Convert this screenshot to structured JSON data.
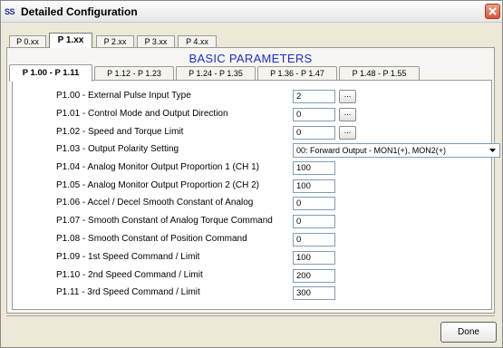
{
  "window": {
    "app_icon_text": "SS",
    "title": "Detailed Configuration"
  },
  "top_tabs": [
    {
      "label": "P 0.xx",
      "active": false
    },
    {
      "label": "P 1.xx",
      "active": true
    },
    {
      "label": "P 2.xx",
      "active": false
    },
    {
      "label": "P 3.xx",
      "active": false
    },
    {
      "label": "P 4.xx",
      "active": false
    }
  ],
  "heading": "BASIC PARAMETERS",
  "sub_tabs": [
    {
      "label": "P 1.00 - P 1.11",
      "active": true
    },
    {
      "label": "P 1.12 - P 1.23",
      "active": false
    },
    {
      "label": "P 1.24 - P 1.35",
      "active": false
    },
    {
      "label": "P 1.36 - P 1.47",
      "active": false
    },
    {
      "label": "P 1.48 - P 1.55",
      "active": false
    }
  ],
  "params": [
    {
      "label": "P1.00 - External Pulse Input Type",
      "value": "2",
      "browse": "..."
    },
    {
      "label": "P1.01 - Control Mode and Output Direction",
      "value": "0",
      "browse": "..."
    },
    {
      "label": "P1.02 - Speed and Torque Limit",
      "value": "0",
      "browse": "..."
    },
    {
      "label": "P1.03 - Output Polarity Setting",
      "value": "00: Forward Output - MON1(+), MON2(+)"
    },
    {
      "label": "P1.04 - Analog Monitor Output Proportion 1 (CH 1)",
      "value": "100"
    },
    {
      "label": "P1.05 - Analog Monitor Output Proportion 2 (CH 2)",
      "value": "100"
    },
    {
      "label": "P1.06 - Accel / Decel Smooth Constant of Analog",
      "value": "0"
    },
    {
      "label": "P1.07 - Smooth Constant of Analog Torque Command",
      "value": "0"
    },
    {
      "label": "P1.08 - Smooth Constant of Position Command",
      "value": "0"
    },
    {
      "label": "P1.09 - 1st Speed Command / Limit",
      "value": "100"
    },
    {
      "label": "P1.10 - 2nd Speed Command / Limit",
      "value": "200"
    },
    {
      "label": "P1.11 - 3rd Speed Command / Limit",
      "value": "300"
    }
  ],
  "done_label": "Done",
  "icons": {
    "close": "close-icon",
    "dropdown": "chevron-down-icon"
  },
  "colors": {
    "heading": "#1b2fcc",
    "close_button": "#d8553a"
  }
}
